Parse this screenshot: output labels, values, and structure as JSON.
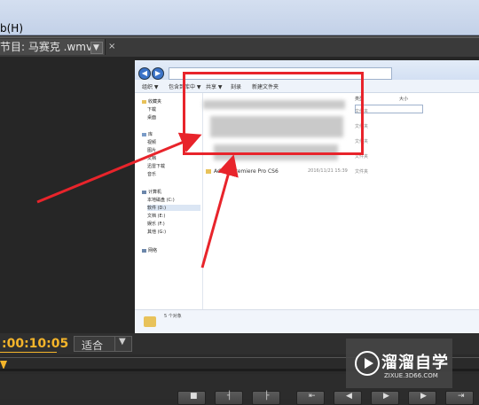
{
  "menubar": {
    "help_label": "b(H)"
  },
  "tab": {
    "title": "节目: 马赛克 .wmv",
    "dropdown_glyph": "▼",
    "close_glyph": "×"
  },
  "screenshot": {
    "toolbar": {
      "organize": "组织 ▼",
      "include": "包含到库中 ▼",
      "share": "共享 ▼",
      "burn": "刻录",
      "new_folder": "新建文件夹"
    },
    "nav": {
      "favorites_header": "收藏夹",
      "favorites": [
        "下载",
        "桌面"
      ],
      "libraries_header": "库",
      "libraries": [
        "视频",
        "图片",
        "文档",
        "迅雷下载",
        "音乐"
      ],
      "computer_header": "计算机",
      "drives": [
        "本地磁盘 (C:)",
        "软件 (D:)",
        "文档 (E:)",
        "娱乐 (F:)",
        "其他 (G:)"
      ],
      "network": "网络"
    },
    "columns": {
      "type": "类型",
      "size": "大小"
    },
    "type_values": [
      "文件夹",
      "文件夹",
      "文件夹",
      "文件夹",
      "文件夹"
    ],
    "file": {
      "name": "Adobe Premiere Pro CS6",
      "date": "2016/11/21 15:39"
    },
    "status_text": "5 个对象"
  },
  "controls": {
    "timecode": ":00:10:05",
    "fit_label": "适合",
    "fit_arrow": "▼",
    "transport_glyphs": [
      "■",
      "┤",
      "├",
      "⇤",
      "◀",
      "▶",
      "▶",
      "⇥"
    ]
  },
  "watermark": {
    "title": "溜溜自学",
    "url": "ZIXUE.3D66.COM"
  },
  "colors": {
    "timecode": "#f5b52a",
    "highlight": "#e8242b",
    "arrow": "#e8242b"
  }
}
